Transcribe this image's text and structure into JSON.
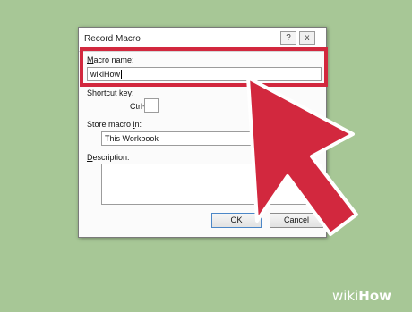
{
  "dialog": {
    "title": "Record Macro",
    "help_glyph": "?",
    "close_glyph": "x",
    "macro_name": {
      "label_underlined": "M",
      "label_rest": "acro name:",
      "value": "wikiHow"
    },
    "shortcut": {
      "label_pre": "Shortcut ",
      "label_underlined": "k",
      "label_post": "ey:",
      "modifier": "Ctrl+",
      "value": ""
    },
    "store": {
      "label_pre": "Store macro ",
      "label_underlined": "i",
      "label_post": "n:",
      "value": "This Workbook"
    },
    "description": {
      "label_underlined": "D",
      "label_rest": "escription:",
      "value": ""
    },
    "buttons": {
      "ok": "OK",
      "cancel": "Cancel"
    }
  },
  "overlay": {
    "highlight_color": "#d2283e",
    "arrow_color": "#d2283e"
  },
  "watermark": {
    "prefix": "wiki",
    "suffix": "How"
  }
}
